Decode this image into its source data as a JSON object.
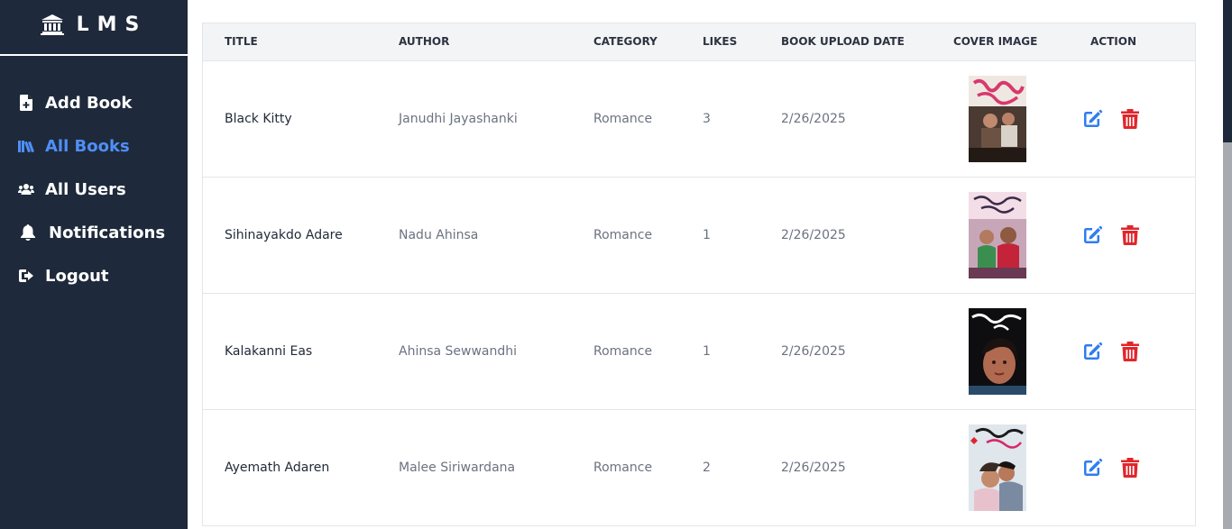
{
  "app": {
    "brand": "LMS",
    "icons": {
      "brand": "library-building-icon",
      "add_book": "file-plus-icon",
      "all_books": "books-icon",
      "all_users": "users-icon",
      "notifications": "bell-icon",
      "logout": "logout-icon",
      "edit": "edit-icon",
      "delete": "trash-icon"
    },
    "colors": {
      "sidebar_bg": "#1e2a3b",
      "active_link": "#4f8ff7",
      "edit_icon": "#2f7df0",
      "delete_icon": "#e0262b"
    }
  },
  "sidebar": {
    "items": [
      {
        "label": "Add Book"
      },
      {
        "label": "All Books",
        "active": true
      },
      {
        "label": "All Users"
      },
      {
        "label": "Notifications"
      },
      {
        "label": "Logout"
      }
    ]
  },
  "table": {
    "headers": {
      "title": "TITLE",
      "author": "AUTHOR",
      "category": "CATEGORY",
      "likes": "LIKES",
      "upload_date": "BOOK UPLOAD DATE",
      "cover": "COVER IMAGE",
      "action": "ACTION"
    },
    "rows": [
      {
        "title": "Black Kitty",
        "author": "Janudhi Jayashanki",
        "category": "Romance",
        "likes": "3",
        "date": "2/26/2025"
      },
      {
        "title": "Sihinayakdo Adare",
        "author": "Nadu Ahinsa",
        "category": "Romance",
        "likes": "1",
        "date": "2/26/2025"
      },
      {
        "title": "Kalakanni Eas",
        "author": "Ahinsa Sewwandhi",
        "category": "Romance",
        "likes": "1",
        "date": "2/26/2025"
      },
      {
        "title": "Ayemath Adaren",
        "author": "Malee Siriwardana",
        "category": "Romance",
        "likes": "2",
        "date": "2/26/2025"
      }
    ]
  }
}
